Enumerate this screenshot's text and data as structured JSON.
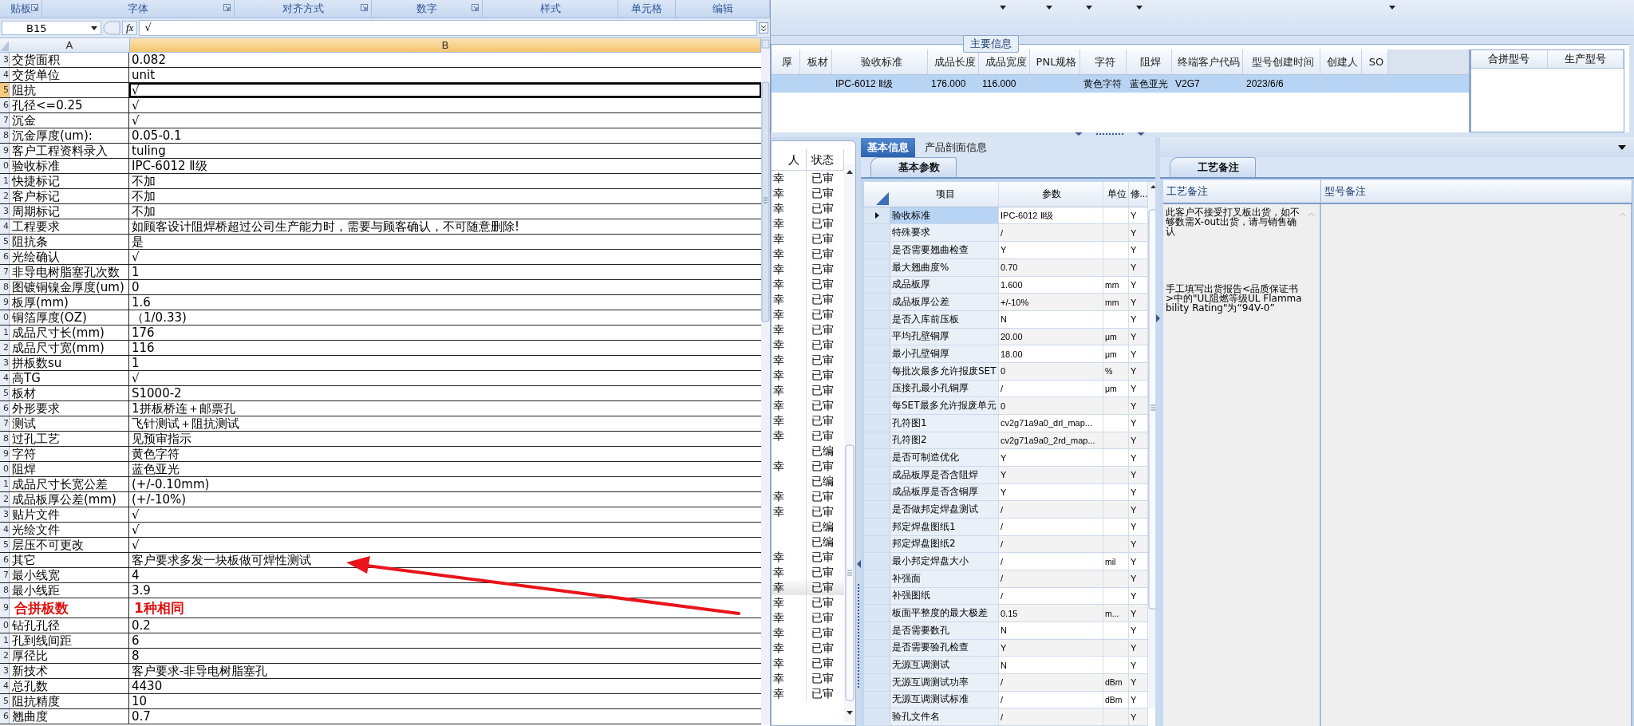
{
  "excel": {
    "ribbon_groups": [
      {
        "label": "贴板",
        "launcher": true
      },
      {
        "label": "字体",
        "launcher": true
      },
      {
        "label": "对齐方式",
        "launcher": true
      },
      {
        "label": "数字",
        "launcher": true
      },
      {
        "label": "样式",
        "launcher": false
      },
      {
        "label": "单元格",
        "launcher": false
      },
      {
        "label": "编辑",
        "launcher": false
      }
    ],
    "name_box": "B15",
    "function_label": "fx",
    "formula": "√",
    "columns": [
      {
        "label": "A",
        "selected": false
      },
      {
        "label": "B",
        "selected": true
      }
    ],
    "rows": [
      {
        "row_number": "3",
        "label": "交货面积",
        "value": "0.082",
        "selected": false,
        "emphasized": false
      },
      {
        "row_number": "4",
        "label": "交货单位",
        "value": "unit",
        "selected": false,
        "emphasized": false
      },
      {
        "row_number": "5",
        "label": "阻抗",
        "value": "√",
        "selected": true,
        "emphasized": false
      },
      {
        "row_number": "6",
        "label": "孔径<=0.25",
        "value": "√",
        "selected": false,
        "emphasized": false
      },
      {
        "row_number": "7",
        "label": "沉金",
        "value": "√",
        "selected": false,
        "emphasized": false
      },
      {
        "row_number": "8",
        "label": "沉金厚度(um):",
        "value": "0.05-0.1",
        "selected": false,
        "emphasized": false
      },
      {
        "row_number": "9",
        "label": "客户工程资料录入",
        "value": "tuling",
        "selected": false,
        "emphasized": false
      },
      {
        "row_number": "0",
        "label": "验收标准",
        "value": "IPC-6012 Ⅱ级",
        "selected": false,
        "emphasized": false
      },
      {
        "row_number": "1",
        "label": "快捷标记",
        "value": "不加",
        "selected": false,
        "emphasized": false
      },
      {
        "row_number": "2",
        "label": "客户标记",
        "value": "不加",
        "selected": false,
        "emphasized": false
      },
      {
        "row_number": "3",
        "label": "周期标记",
        "value": "不加",
        "selected": false,
        "emphasized": false
      },
      {
        "row_number": "4",
        "label": "工程要求",
        "value": "如顾客设计阻焊桥超过公司生产能力时，需要与顾客确认，不可随意删除!",
        "selected": false,
        "emphasized": false
      },
      {
        "row_number": "5",
        "label": "阻抗条",
        "value": "是",
        "selected": false,
        "emphasized": false
      },
      {
        "row_number": "6",
        "label": "光绘确认",
        "value": "√",
        "selected": false,
        "emphasized": false
      },
      {
        "row_number": "7",
        "label": "非导电树脂塞孔次数",
        "value": "1",
        "selected": false,
        "emphasized": false
      },
      {
        "row_number": "8",
        "label": "图镀铜镍金厚度(um)",
        "value": "0",
        "selected": false,
        "emphasized": false
      },
      {
        "row_number": "9",
        "label": "板厚(mm)",
        "value": "1.6",
        "selected": false,
        "emphasized": false
      },
      {
        "row_number": "0",
        "label": "铜箔厚度(OZ)",
        "value": "（1/0.33)",
        "selected": false,
        "emphasized": false
      },
      {
        "row_number": "1",
        "label": "成品尺寸长(mm)",
        "value": "176",
        "selected": false,
        "emphasized": false
      },
      {
        "row_number": "2",
        "label": "成品尺寸宽(mm)",
        "value": "116",
        "selected": false,
        "emphasized": false
      },
      {
        "row_number": "3",
        "label": "拼板数su",
        "value": "1",
        "selected": false,
        "emphasized": false
      },
      {
        "row_number": "4",
        "label": "高TG",
        "value": "√",
        "selected": false,
        "emphasized": false
      },
      {
        "row_number": "5",
        "label": "板材",
        "value": "S1000-2",
        "selected": false,
        "emphasized": false
      },
      {
        "row_number": "6",
        "label": "外形要求",
        "value": "1拼板桥连＋邮票孔",
        "selected": false,
        "emphasized": false
      },
      {
        "row_number": "7",
        "label": "测试",
        "value": "飞针测试＋阻抗测试",
        "selected": false,
        "emphasized": false
      },
      {
        "row_number": "8",
        "label": "过孔工艺",
        "value": "见预审指示",
        "selected": false,
        "emphasized": false
      },
      {
        "row_number": "9",
        "label": "字符",
        "value": "黄色字符",
        "selected": false,
        "emphasized": false
      },
      {
        "row_number": "0",
        "label": "阻焊",
        "value": "蓝色亚光",
        "selected": false,
        "emphasized": false
      },
      {
        "row_number": "1",
        "label": "成品尺寸长宽公差",
        "value": "(+/-0.10mm)",
        "selected": false,
        "emphasized": false
      },
      {
        "row_number": "2",
        "label": "成品板厚公差(mm)",
        "value": "(+/-10%)",
        "selected": false,
        "emphasized": false
      },
      {
        "row_number": "3",
        "label": "贴片文件",
        "value": "√",
        "selected": false,
        "emphasized": false
      },
      {
        "row_number": "4",
        "label": "光绘文件",
        "value": "√",
        "selected": false,
        "emphasized": false
      },
      {
        "row_number": "5",
        "label": "层压不可更改",
        "value": "√",
        "selected": false,
        "emphasized": false
      },
      {
        "row_number": "6",
        "label": "其它",
        "value": "客户要求多发一块板做可焊性测试",
        "selected": false,
        "emphasized": false
      },
      {
        "row_number": "7",
        "label": "最小线宽",
        "value": "4",
        "selected": false,
        "emphasized": false
      },
      {
        "row_number": "8",
        "label": "最小线距",
        "value": "3.9",
        "selected": false,
        "emphasized": false
      },
      {
        "row_number": "9",
        "label": "合拼板数",
        "value": "1种相同",
        "selected": false,
        "emphasized": true
      },
      {
        "row_number": "0",
        "label": "钻孔孔径",
        "value": "0.2",
        "selected": false,
        "emphasized": false
      },
      {
        "row_number": "1",
        "label": "孔到线间距",
        "value": "6",
        "selected": false,
        "emphasized": false
      },
      {
        "row_number": "2",
        "label": "厚径比",
        "value": "8",
        "selected": false,
        "emphasized": false
      },
      {
        "row_number": "3",
        "label": "新技术",
        "value": "客户要求-非导电树脂塞孔",
        "selected": false,
        "emphasized": false
      },
      {
        "row_number": "4",
        "label": "总孔数",
        "value": "4430",
        "selected": false,
        "emphasized": false
      },
      {
        "row_number": "5",
        "label": "阻抗精度",
        "value": "10",
        "selected": false,
        "emphasized": false
      },
      {
        "row_number": "6",
        "label": "翘曲度",
        "value": "0.7",
        "selected": false,
        "emphasized": false
      }
    ]
  },
  "main_info": {
    "title": "主要信息",
    "columns": [
      "厚",
      "板材",
      "验收标准",
      "成品长度",
      "成品宽度",
      "PNL规格",
      "字符",
      "阻焊",
      "终端客户代码",
      "型号创建时间",
      "创建人",
      "SO"
    ],
    "rows": [
      {
        "selected": true,
        "cells": [
          {},
          {},
          {
            "text": "IPC-6012 Ⅱ级"
          },
          {
            "text": "176.000"
          },
          {
            "text": "116.000"
          },
          {},
          {
            "text": "黄色字符"
          },
          {
            "text": "蓝色亚光"
          },
          {
            "text": "V2G7"
          },
          {
            "text": "2023/6/6"
          },
          {},
          {}
        ]
      }
    ],
    "side_columns": [
      "合拼型号",
      "生产型号"
    ]
  },
  "review_list": {
    "columns": [
      "人",
      "状态"
    ],
    "rows": [
      {
        "person": "幸",
        "status": "已审",
        "selected": false
      },
      {
        "person": "幸",
        "status": "已审",
        "selected": false
      },
      {
        "person": "幸",
        "status": "已审",
        "selected": false
      },
      {
        "person": "幸",
        "status": "已审",
        "selected": false
      },
      {
        "person": "幸",
        "status": "已审",
        "selected": false
      },
      {
        "person": "幸",
        "status": "已审",
        "selected": false
      },
      {
        "person": "幸",
        "status": "已审",
        "selected": false
      },
      {
        "person": "幸",
        "status": "已审",
        "selected": false
      },
      {
        "person": "幸",
        "status": "已审",
        "selected": false
      },
      {
        "person": "幸",
        "status": "已审",
        "selected": false
      },
      {
        "person": "幸",
        "status": "已审",
        "selected": false
      },
      {
        "person": "幸",
        "status": "已审",
        "selected": false
      },
      {
        "person": "幸",
        "status": "已审",
        "selected": false
      },
      {
        "person": "幸",
        "status": "已审",
        "selected": false
      },
      {
        "person": "幸",
        "status": "已审",
        "selected": false
      },
      {
        "person": "幸",
        "status": "已审",
        "selected": false
      },
      {
        "person": "幸",
        "status": "已审",
        "selected": false
      },
      {
        "person": "幸",
        "status": "已审",
        "selected": false
      },
      {
        "status": "已编",
        "selected": false
      },
      {
        "person": "幸",
        "status": "已审",
        "selected": false
      },
      {
        "status": "已编",
        "selected": false
      },
      {
        "person": "幸",
        "status": "已审",
        "selected": false
      },
      {
        "person": "幸",
        "status": "已审",
        "selected": false
      },
      {
        "status": "已编",
        "selected": false
      },
      {
        "status": "已编",
        "selected": false
      },
      {
        "person": "幸",
        "status": "已审",
        "selected": false
      },
      {
        "person": "幸",
        "status": "已审",
        "selected": false
      },
      {
        "person": "幸",
        "status": "已审",
        "selected": true
      },
      {
        "person": "幸",
        "status": "已审",
        "selected": false
      },
      {
        "person": "幸",
        "status": "已审",
        "selected": false
      },
      {
        "person": "幸",
        "status": "已审",
        "selected": false
      },
      {
        "person": "幸",
        "status": "已审",
        "selected": false
      },
      {
        "person": "幸",
        "status": "已审",
        "selected": false
      },
      {
        "person": "幸",
        "status": "已审",
        "selected": false
      },
      {
        "person": "幸",
        "status": "已审",
        "selected": false
      }
    ]
  },
  "info_tabs": [
    {
      "label": "基本信息",
      "selected": true
    },
    {
      "label": "产品剖面信息",
      "selected": false
    }
  ],
  "param_tabs": [
    {
      "label": "基本参数",
      "selected": true
    }
  ],
  "params": {
    "columns": [
      "项目",
      "参数",
      "单位",
      "修..."
    ],
    "rows": [
      {
        "item": "验收标准",
        "value": "IPC-6012 Ⅱ级",
        "flag": "Y",
        "current": true
      },
      {
        "item": "特殊要求",
        "value": "/",
        "flag": "Y",
        "current": false
      },
      {
        "item": "是否需要翘曲检查",
        "value": "Y",
        "flag": "Y",
        "current": false
      },
      {
        "item": "最大翘曲度%",
        "value": "0.70",
        "flag": "Y",
        "current": false
      },
      {
        "item": "成品板厚",
        "value": "1.600",
        "unit": "mm",
        "flag": "Y",
        "current": false
      },
      {
        "item": "成品板厚公差",
        "value": "+/-10%",
        "unit": "mm",
        "flag": "Y",
        "current": false
      },
      {
        "item": "是否入库前压板",
        "value": "N",
        "flag": "Y",
        "current": false
      },
      {
        "item": "平均孔壁铜厚",
        "value": "20.00",
        "unit": "μm",
        "flag": "Y",
        "current": false
      },
      {
        "item": "最小孔壁铜厚",
        "value": "18.00",
        "unit": "μm",
        "flag": "Y",
        "current": false
      },
      {
        "item": "每批次最多允许报废SET",
        "value": "0",
        "unit": "%",
        "flag": "Y",
        "current": false
      },
      {
        "item": "压接孔最小孔铜厚",
        "value": "/",
        "unit": "μm",
        "flag": "Y",
        "current": false
      },
      {
        "item": "每SET最多允许报废单元",
        "value": "0",
        "flag": "Y",
        "current": false
      },
      {
        "item": "孔符图1",
        "value": "cv2g71a9a0_drl_map...",
        "flag": "Y",
        "current": false
      },
      {
        "item": "孔符图2",
        "value": "cv2g71a9a0_2rd_map...",
        "flag": "Y",
        "current": false
      },
      {
        "item": "是否可制造优化",
        "value": "Y",
        "flag": "Y",
        "current": false
      },
      {
        "item": "成品板厚是否含阻焊",
        "value": "Y",
        "flag": "Y",
        "current": false
      },
      {
        "item": "成品板厚是否含铜厚",
        "value": "Y",
        "flag": "Y",
        "current": false
      },
      {
        "item": "是否做邦定焊盘测试",
        "value": "/",
        "flag": "Y",
        "current": false
      },
      {
        "item": "邦定焊盘图纸1",
        "value": "/",
        "flag": "Y",
        "current": false
      },
      {
        "item": "邦定焊盘图纸2",
        "value": "/",
        "flag": "Y",
        "current": false
      },
      {
        "item": "最小邦定焊盘大小",
        "value": "/",
        "unit": "mil",
        "flag": "Y",
        "current": false
      },
      {
        "item": "补强面",
        "value": "/",
        "flag": "Y",
        "current": false
      },
      {
        "item": "补强图纸",
        "value": "/",
        "flag": "Y",
        "current": false
      },
      {
        "item": "板面平整度的最大极差",
        "value": "0.15",
        "unit": "m...",
        "flag": "Y",
        "current": false
      },
      {
        "item": "是否需要数孔",
        "value": "N",
        "flag": "Y",
        "current": false
      },
      {
        "item": "是否需要验孔检查",
        "value": "Y",
        "flag": "Y",
        "current": false
      },
      {
        "item": "无源互调测试",
        "value": "N",
        "flag": "Y",
        "current": false
      },
      {
        "item": "无源互调测试功率",
        "value": "/",
        "unit": "dBm",
        "flag": "Y",
        "current": false
      },
      {
        "item": "无源互调测试标准",
        "value": "/",
        "unit": "dBm",
        "flag": "Y",
        "current": false
      },
      {
        "item": "验孔文件名",
        "value": "/",
        "flag": "Y",
        "current": false
      }
    ]
  },
  "notes_tabs": [
    {
      "label": "工艺备注",
      "selected": true
    }
  ],
  "notes": {
    "columns": [
      "工艺备注",
      "型号备注"
    ],
    "process_note": [
      "此客户不接受打叉板出货，如不够数需X-out出货，请与销售确认",
      "手工填写出货报告<品质保证书>中的\"UL阻燃等级UL Flammability Rating\"为“94V-0”"
    ]
  }
}
